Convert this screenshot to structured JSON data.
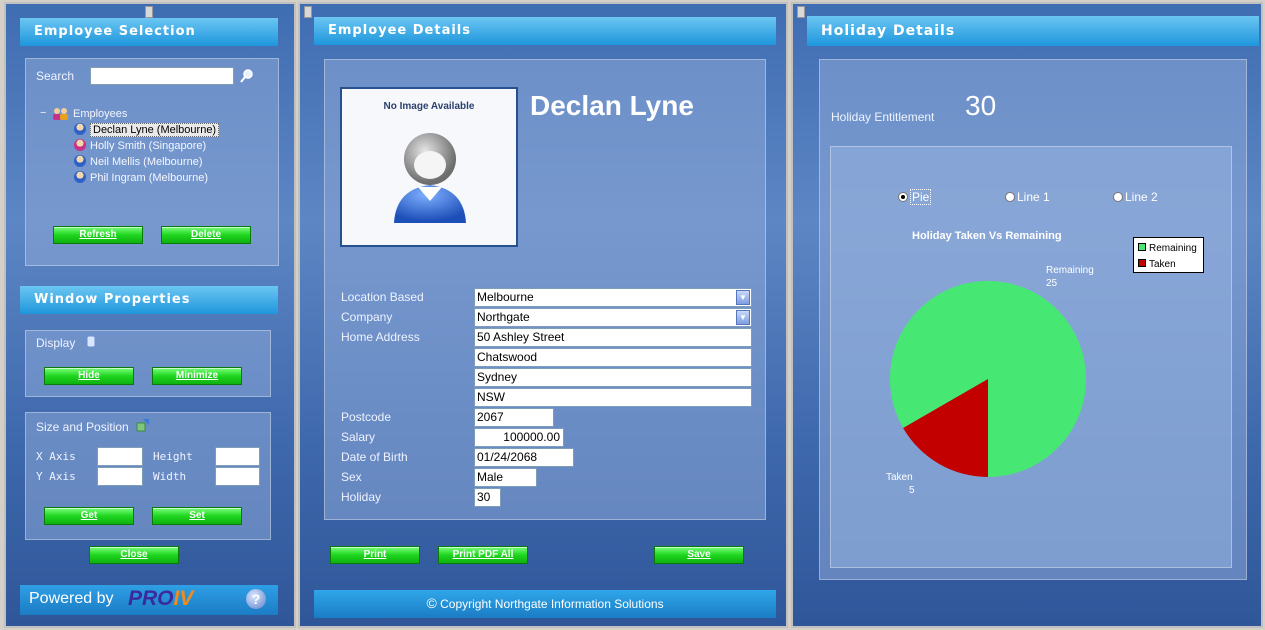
{
  "employee_selection": {
    "title": "Employee Selection",
    "search_label": "Search",
    "search_value": "",
    "tree_root": "Employees",
    "employees": [
      "Declan Lyne (Melbourne)",
      "Holly Smith (Singapore)",
      "Neil Mellis (Melbourne)",
      "Phil Ingram (Melbourne)"
    ],
    "refresh_label": "Refresh",
    "delete_label": "Delete"
  },
  "window_properties": {
    "title": "Window Properties",
    "display_label": "Display",
    "hide_label": "Hide",
    "minimize_label": "Minimize",
    "size_position_label": "Size and Position",
    "x_axis_label": "X Axis",
    "y_axis_label": "Y Axis",
    "height_label": "Height",
    "width_label": "Width",
    "get_label": "Get",
    "set_label": "Set",
    "close_label": "Close"
  },
  "footer": {
    "powered_by": "Powered by",
    "brand": "PRO",
    "brand_suffix": "IV",
    "help": "?"
  },
  "employee_details": {
    "title": "Employee Details",
    "no_image": "No Image Available",
    "name": "Declan Lyne",
    "labels": {
      "location": "Location Based",
      "company": "Company",
      "address": "Home Address",
      "postcode": "Postcode",
      "salary": "Salary",
      "dob": "Date of Birth",
      "sex": "Sex",
      "holiday": "Holiday"
    },
    "values": {
      "location": "Melbourne",
      "company": "Northgate",
      "address1": "50 Ashley Street",
      "address2": "Chatswood",
      "address3": "Sydney",
      "address4": "NSW",
      "postcode": "2067",
      "salary": "100000.00",
      "dob": "01/24/2068",
      "sex": "Male",
      "holiday": "30"
    },
    "print_label": "Print",
    "print_pdf_label": "Print PDF All",
    "save_label": "Save",
    "copyright": "Copyright Northgate Information Solutions"
  },
  "holiday_details": {
    "title": "Holiday Details",
    "entitlement_label": "Holiday Entitlement",
    "entitlement_value": "30",
    "radio_pie": "Pie",
    "radio_line1": "Line 1",
    "radio_line2": "Line 2",
    "selected_radio": "Pie"
  },
  "chart_data": {
    "type": "pie",
    "title": "Holiday Taken Vs Remaining",
    "legend_position": "top-right",
    "slices": [
      {
        "name": "Remaining",
        "value": 25,
        "color": "#46e873"
      },
      {
        "name": "Taken",
        "value": 5,
        "color": "#c20000"
      }
    ]
  },
  "colors": {
    "accent_title": "#1e96dc",
    "button_green": "#1fd61f",
    "panel_blue": "#3f6db2"
  }
}
